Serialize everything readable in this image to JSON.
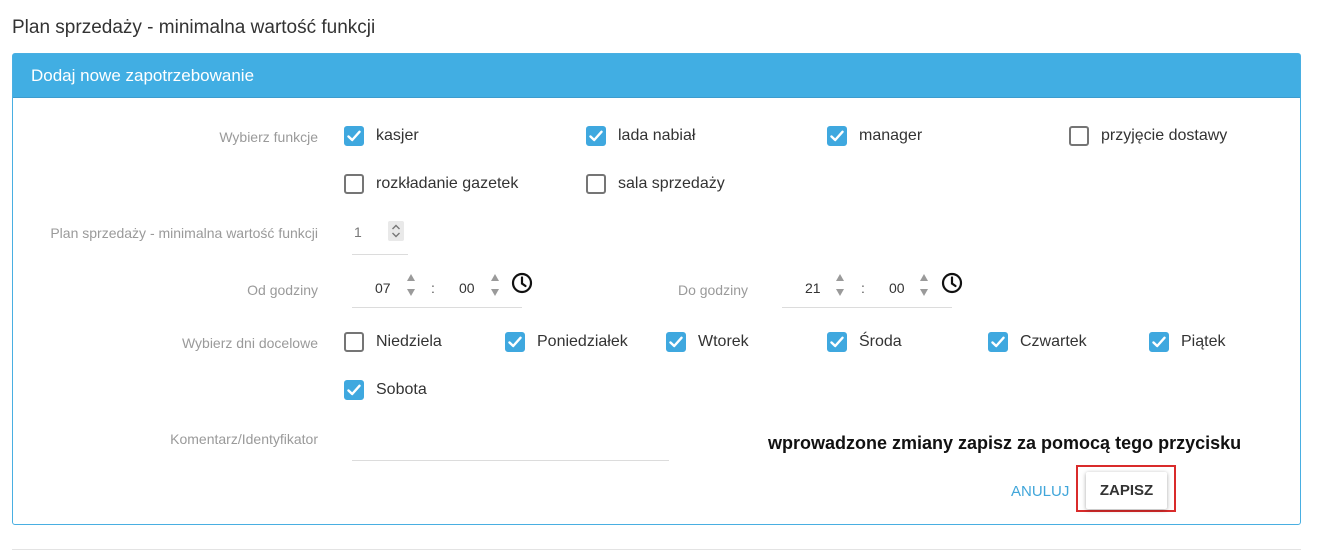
{
  "page": {
    "title": "Plan sprzedaży - minimalna wartość funkcji"
  },
  "panel": {
    "header": "Dodaj nowe zapotrzebowanie"
  },
  "functions": {
    "label": "Wybierz funkcje",
    "options": [
      {
        "label": "kasjer",
        "checked": true
      },
      {
        "label": "lada nabiał",
        "checked": true
      },
      {
        "label": "manager",
        "checked": true
      },
      {
        "label": "przyjęcie dostawy",
        "checked": false
      },
      {
        "label": "rozkładanie gazetek",
        "checked": false
      },
      {
        "label": "sala sprzedaży",
        "checked": false
      }
    ]
  },
  "min_value": {
    "label": "Plan sprzedaży - minimalna wartość funkcji",
    "value": "1"
  },
  "time_from": {
    "label": "Od godziny",
    "hours": "07",
    "separator": ":",
    "minutes": "00"
  },
  "time_to": {
    "label": "Do godziny",
    "hours": "21",
    "separator": ":",
    "minutes": "00"
  },
  "days": {
    "label": "Wybierz dni docelowe",
    "options": [
      {
        "label": "Niedziela",
        "checked": false
      },
      {
        "label": "Poniedziałek",
        "checked": true
      },
      {
        "label": "Wtorek",
        "checked": true
      },
      {
        "label": "Środa",
        "checked": true
      },
      {
        "label": "Czwartek",
        "checked": true
      },
      {
        "label": "Piątek",
        "checked": true
      },
      {
        "label": "Sobota",
        "checked": true
      }
    ]
  },
  "comment": {
    "label": "Komentarz/Identyfikator",
    "value": ""
  },
  "hint": "wprowadzone zmiany zapisz za pomocą tego przycisku",
  "actions": {
    "cancel_label": "ANULUJ",
    "save_label": "ZAPISZ"
  },
  "colors": {
    "accent": "#41aee3",
    "checkbox_checked": "#3fa8df",
    "highlight_border": "#d92b2b"
  },
  "icons": {
    "time_picker": "clock-icon",
    "checkbox": "check-icon"
  }
}
